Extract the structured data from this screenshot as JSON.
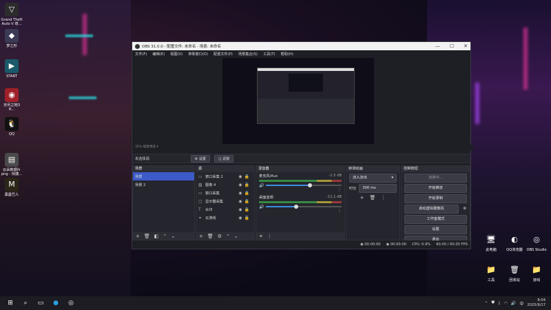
{
  "desktop": {
    "left_icons": [
      {
        "label": "Grand Theft Auto V 增...",
        "icon": "gta-icon",
        "color": "#2c2c2c"
      },
      {
        "label": "梦之形",
        "icon": "dream-app-icon",
        "color": "#3a3a55"
      },
      {
        "label": "START",
        "icon": "start-play-icon",
        "color": "#1a5a6a"
      },
      {
        "label": "无尽之地3 R...",
        "icon": "borderlands-icon",
        "color": "#a0202a"
      },
      {
        "label": "QQ",
        "icon": "qq-icon",
        "color": "#111111"
      },
      {
        "label": "云朵数据片 png - 快捷...",
        "icon": "image-shortcut-icon",
        "color": "#4a4a4a"
      },
      {
        "label": "黑曼巴人",
        "icon": "mamba-icon",
        "color": "#2a2618"
      }
    ],
    "right_icons": [
      {
        "label": "此电脑",
        "icon": "computer-icon"
      },
      {
        "label": "QQ浏览器",
        "icon": "qq-browser-icon"
      },
      {
        "label": "OBS Studio",
        "icon": "obs-icon"
      },
      {
        "label": "工具",
        "icon": "folder-icon"
      },
      {
        "label": "回收站",
        "icon": "recycle-bin-icon"
      },
      {
        "label": "游戏",
        "icon": "folder-icon"
      }
    ]
  },
  "obs": {
    "title": "OBS 31.0.0 - 配置文件: 未命名 - 场景: 未命名",
    "menu": [
      "文件(F)",
      "编辑(E)",
      "视图(V)",
      "停靠窗口(D)",
      "配置文件(P)",
      "场景集合(S)",
      "工具(T)",
      "帮助(H)"
    ],
    "zoom_label": "35%  缩放预览 ▾",
    "scene_bar": {
      "label": "未选择源",
      "settings": "⚙ 设置",
      "filters": "◫ 滤镜"
    },
    "docks": {
      "scenes": {
        "title": "场景",
        "items": [
          "场景",
          "场景 2"
        ],
        "selected": 0
      },
      "sources": {
        "title": "源",
        "items": [
          {
            "label": "窗口采集 2",
            "icon": "window-capture-icon"
          },
          {
            "label": "图像 4",
            "icon": "image-icon"
          },
          {
            "label": "窗口采集",
            "icon": "window-capture-icon"
          },
          {
            "label": "显示器采集",
            "icon": "monitor-icon"
          },
          {
            "label": "水印",
            "icon": "text-icon"
          },
          {
            "label": "云游戏",
            "icon": "link-icon"
          }
        ]
      },
      "mixer": {
        "title": "混音器",
        "channels": [
          {
            "name": "麦克风/Aux",
            "db": "-1.5 dB",
            "level": 0.82
          },
          {
            "name": "桌面音频",
            "db": "-11.1 dB",
            "level": 0.56
          }
        ]
      },
      "transitions": {
        "title": "转场动画",
        "type": "淡入淡出",
        "duration_label": "时长",
        "duration": "300 ms"
      },
      "controls": {
        "title": "控制按钮",
        "buttons": [
          "开始推流",
          "开始录制",
          "启动虚拟摄像机",
          "工作室模式",
          "设置",
          "退出"
        ],
        "status": "连接中..."
      }
    },
    "status": {
      "stream_time": "00:00:00",
      "rec_time": "00:00:00",
      "cpu": "CPU: 0.9%",
      "fps": "60.00 / 60.00 FPS"
    }
  },
  "taskbar": {
    "time": "8:04",
    "date": "2025/9/17",
    "lang": "中"
  }
}
